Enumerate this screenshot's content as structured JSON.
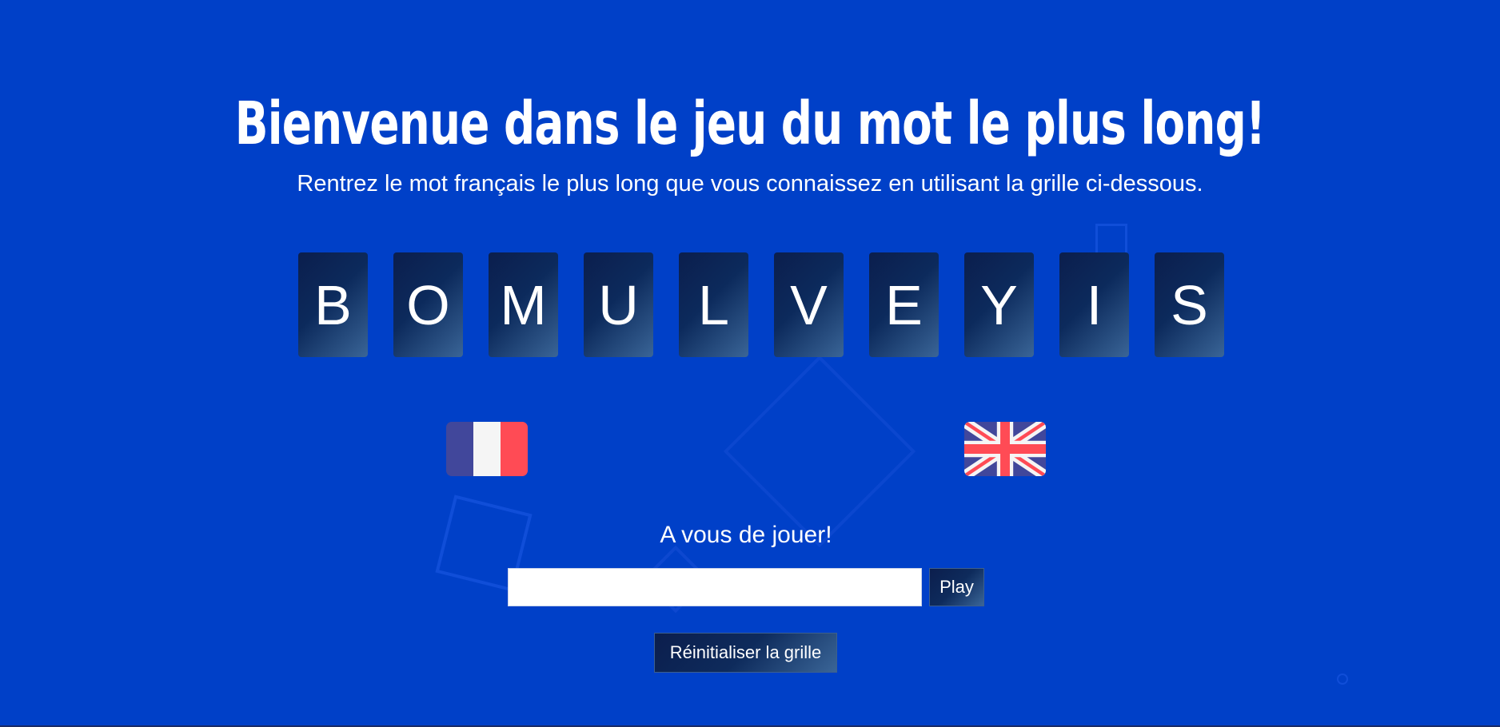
{
  "header": {
    "title": "Bienvenue dans le jeu du mot le plus long!",
    "subtitle": "Rentrez le mot français le plus long que vous connaissez en utilisant la grille ci-dessous."
  },
  "grid": {
    "letters": [
      "B",
      "O",
      "M",
      "U",
      "L",
      "V",
      "E",
      "Y",
      "I",
      "S"
    ]
  },
  "languages": {
    "french_flag_icon": "flag-france-icon",
    "uk_flag_icon": "flag-uk-icon"
  },
  "play": {
    "prompt": "A vous de jouer!",
    "input_value": "",
    "play_label": "Play",
    "reset_label": "Réinitialiser la grille"
  },
  "colors": {
    "background": "#0040c8",
    "tile_dark": "#0b1e4d",
    "tile_light": "#3a6597",
    "text": "#ffffff"
  }
}
